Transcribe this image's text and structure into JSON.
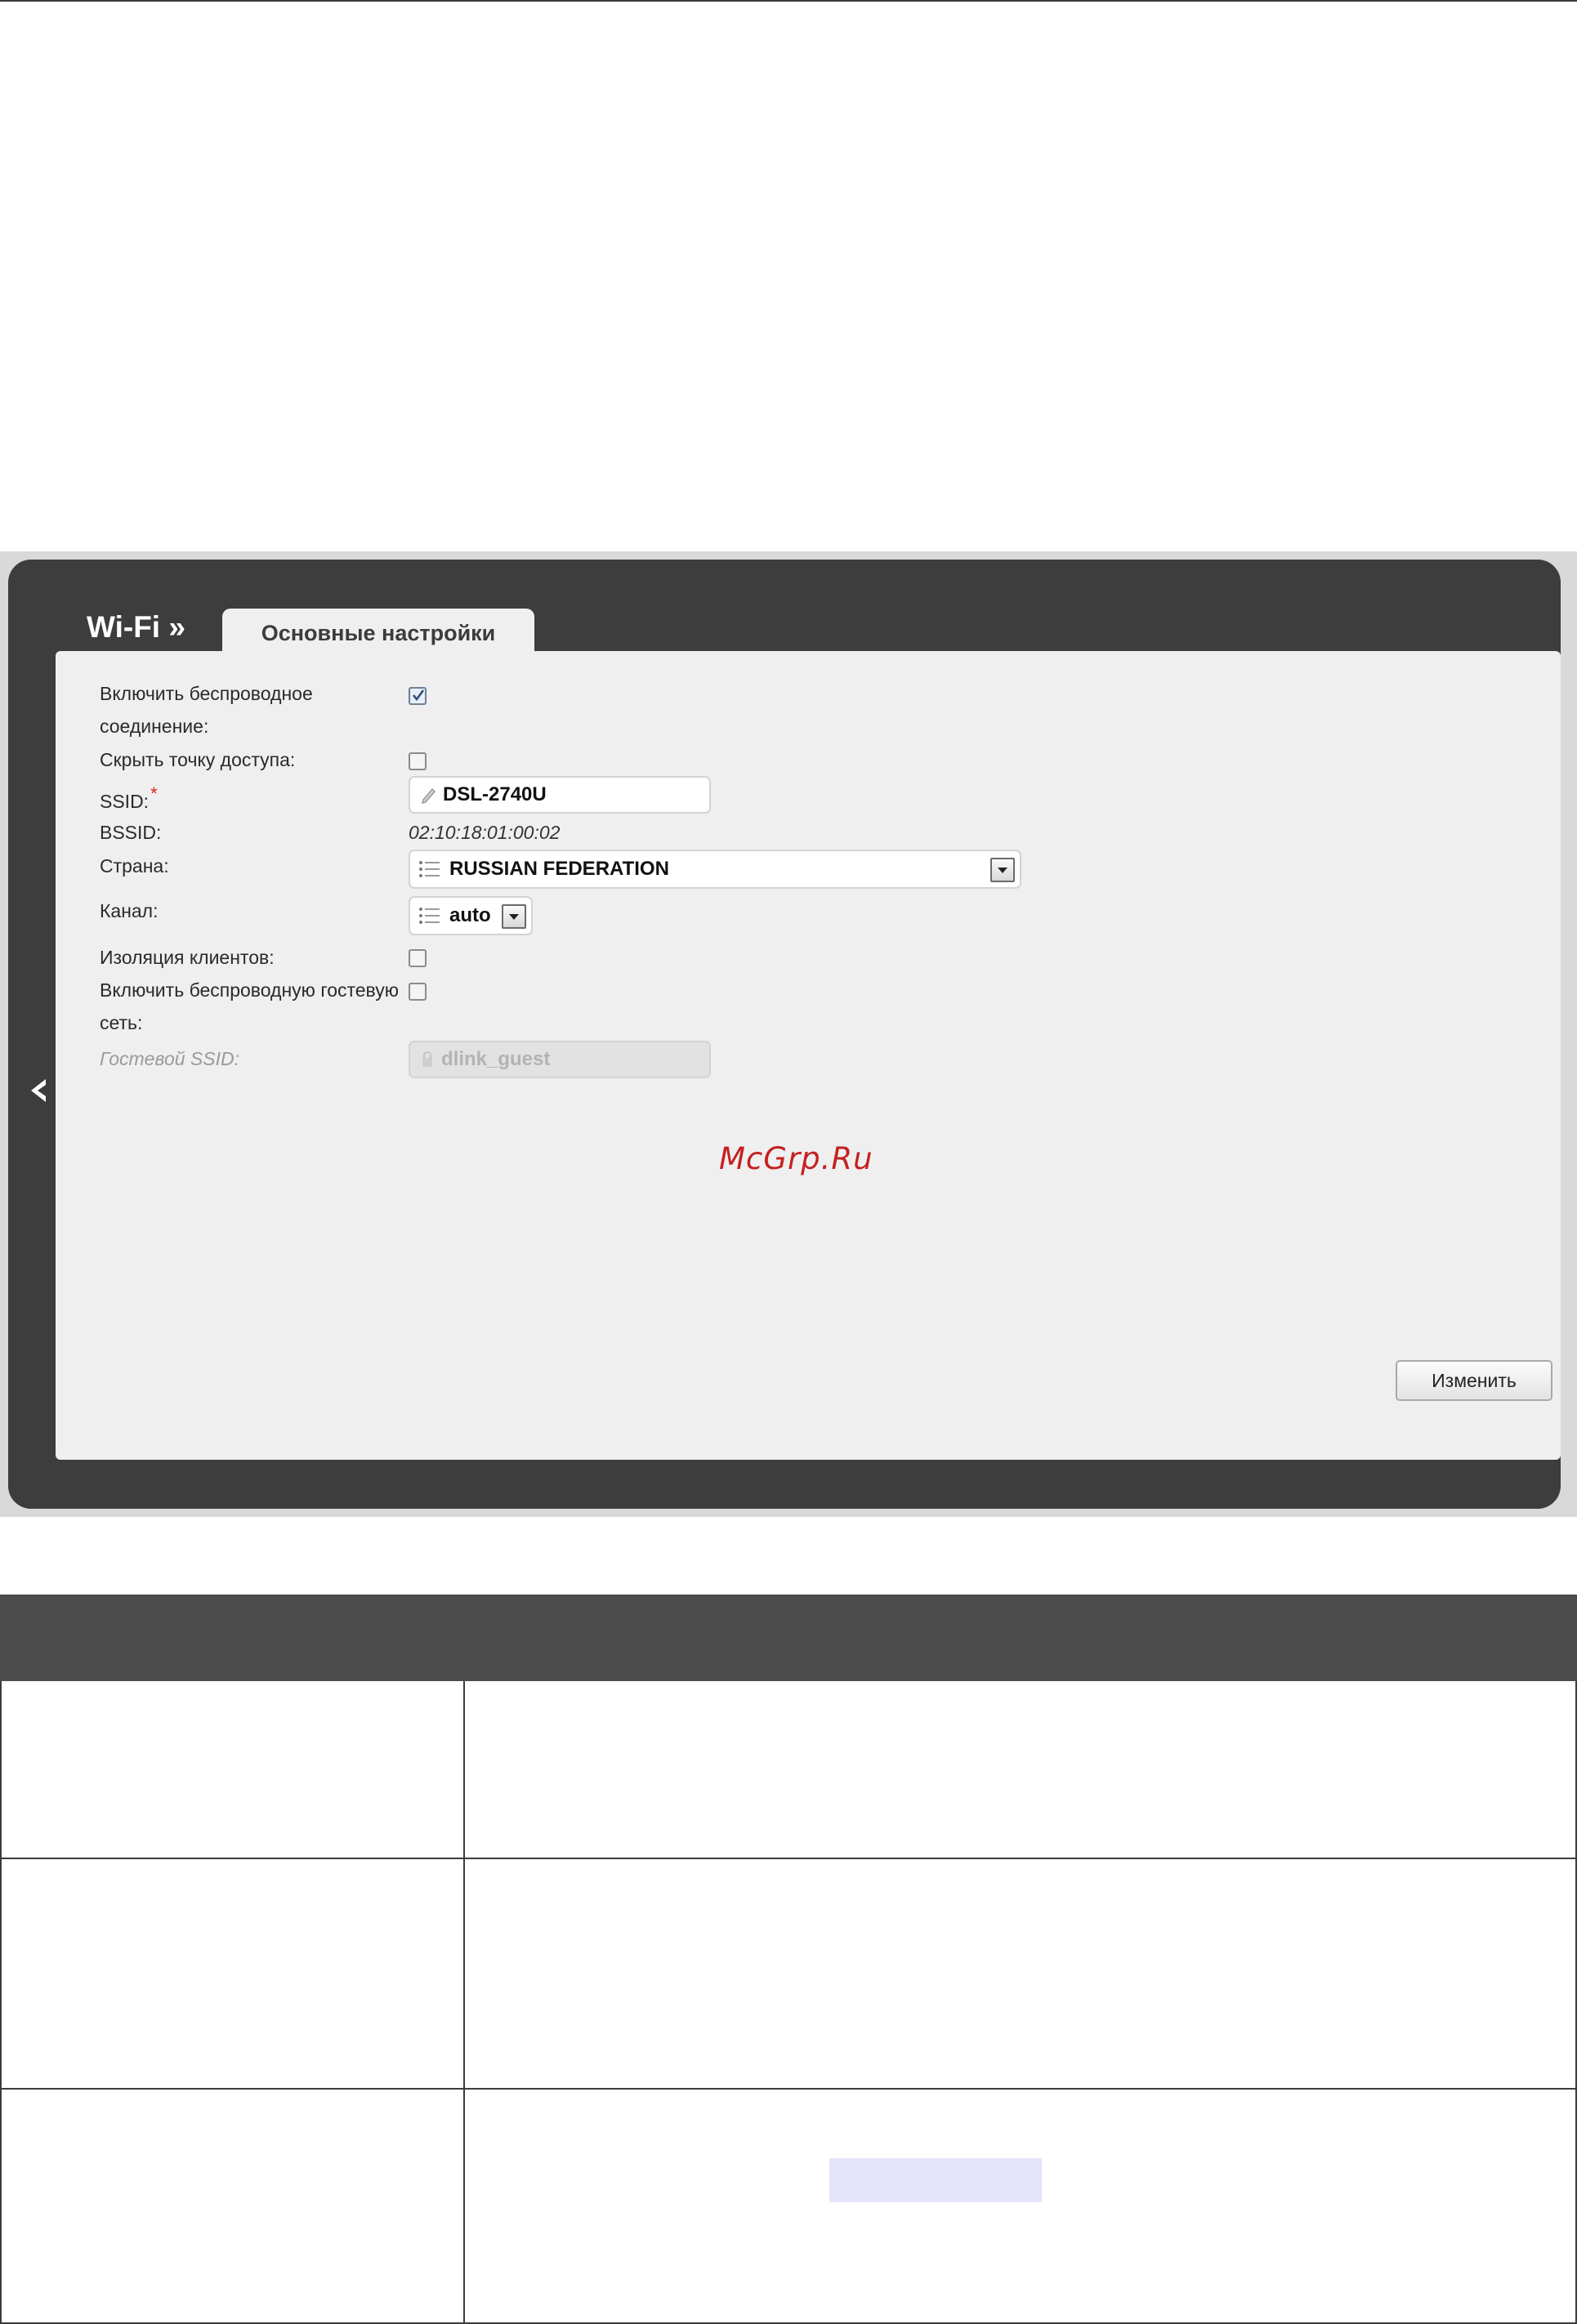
{
  "screen": {
    "section_title": "Wi-Fi »",
    "active_tab": "Основные настройки",
    "fields": {
      "enable_wireless_label_line1": "Включить беспроводное",
      "enable_wireless_label_line2": "соединение:",
      "enable_wireless_checked": true,
      "hide_ap_label": "Скрыть точку доступа:",
      "hide_ap_checked": false,
      "ssid_label": "SSID:",
      "ssid_required_mark": "*",
      "ssid_value": "DSL-2740U",
      "bssid_label": "BSSID:",
      "bssid_value": "02:10:18:01:00:02",
      "country_label": "Страна:",
      "country_value": "RUSSIAN FEDERATION",
      "channel_label": "Канал:",
      "channel_value": "auto",
      "client_isolation_label": "Изоляция клиентов:",
      "client_isolation_checked": false,
      "guest_network_label_line1": "Включить беспроводную гостевую",
      "guest_network_label_line2": "сеть:",
      "guest_network_checked": false,
      "guest_ssid_label": "Гостевой SSID:",
      "guest_ssid_value": "dlink_guest"
    },
    "watermark": "McGrp.Ru",
    "change_button": "Изменить",
    "icons": [
      "back-arrow-icon",
      "checkmark-icon",
      "pencil-icon",
      "list-icon",
      "dropdown-arrow-icon",
      "lock-icon"
    ]
  },
  "colors": {
    "panel_dark": "#3d3d3d",
    "content_bg": "#efefef",
    "required_mark": "#e02020",
    "watermark": "#c42121",
    "table_header": "#4c4c4c",
    "highlight": "#e4e4fb"
  },
  "table": {
    "header_text": "",
    "rows": [
      {
        "name": "",
        "description": ""
      },
      {
        "name": "",
        "description": ""
      },
      {
        "name": "",
        "description": ""
      }
    ]
  }
}
